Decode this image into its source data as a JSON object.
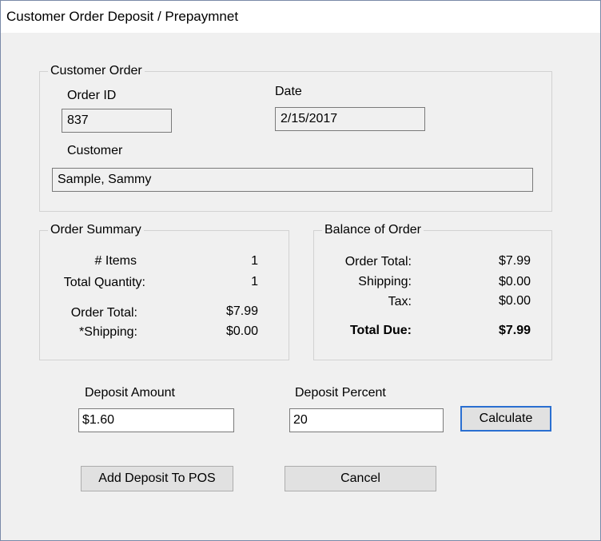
{
  "window": {
    "title": "Customer Order Deposit / Prepaymnet"
  },
  "customer_order": {
    "legend": "Customer Order",
    "order_id_label": "Order ID",
    "order_id_value": "837",
    "date_label": "Date",
    "date_value": "2/15/2017",
    "customer_label": "Customer",
    "customer_value": "Sample, Sammy"
  },
  "order_summary": {
    "legend": "Order Summary",
    "rows": [
      {
        "label": "# Items",
        "value": "1"
      },
      {
        "label": "Total Quantity:",
        "value": "1"
      },
      {
        "label": "Order Total:",
        "value": "$7.99"
      },
      {
        "label": "*Shipping:",
        "value": "$0.00"
      }
    ]
  },
  "balance_of_order": {
    "legend": "Balance of Order",
    "rows": [
      {
        "label": "Order Total:",
        "value": "$7.99"
      },
      {
        "label": "Shipping:",
        "value": "$0.00"
      },
      {
        "label": "Tax:",
        "value": "$0.00"
      }
    ],
    "total_due_label": "Total Due:",
    "total_due_value": "$7.99"
  },
  "deposit": {
    "amount_label": "Deposit Amount",
    "amount_value": "$1.60",
    "percent_label": "Deposit Percent",
    "percent_value": "20",
    "calculate_label": "Calculate"
  },
  "actions": {
    "add_deposit_label": "Add Deposit To POS",
    "cancel_label": "Cancel"
  },
  "colors": {
    "window_border": "#7a8aa8",
    "dialog_background": "#f0f0f0",
    "focus_border": "#2a6fd1"
  }
}
